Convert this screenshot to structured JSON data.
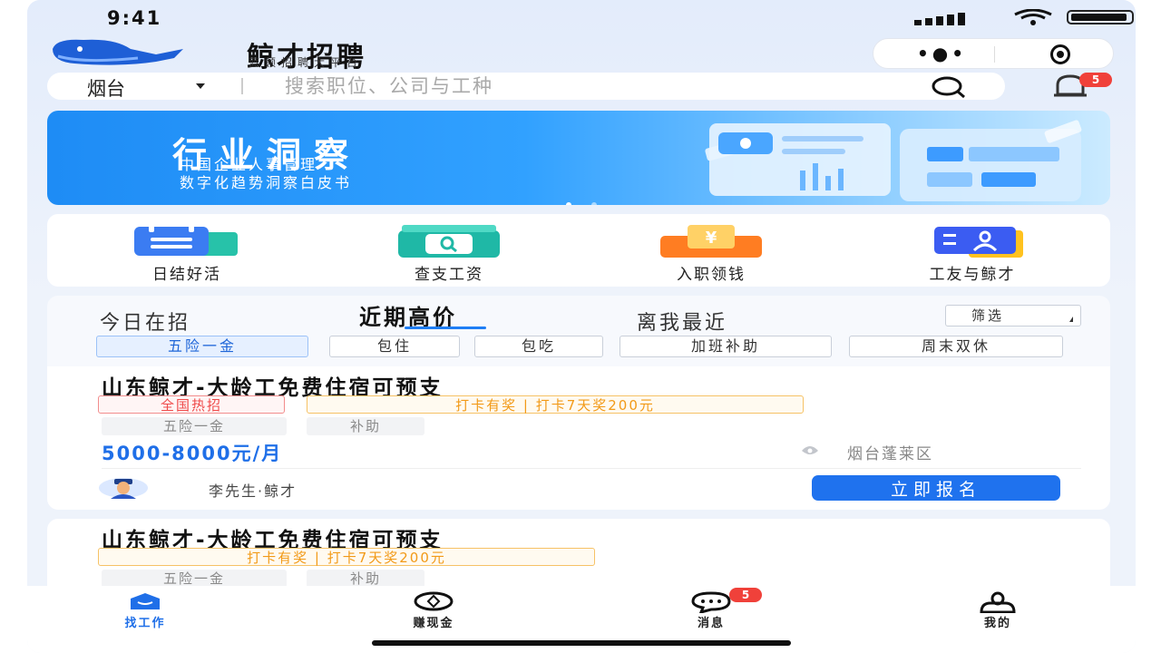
{
  "status_bar": {
    "time": "9:41"
  },
  "header": {
    "app_title": "鲸才招聘",
    "app_subtitle": "蓝领招聘大平台",
    "menu_icon": "more-dots-icon",
    "close_icon": "target-icon"
  },
  "search": {
    "city": "烟台",
    "placeholder": "搜索职位、公司与工种",
    "notification_count": "5"
  },
  "banner": {
    "title": "行业洞察",
    "subtitle_line1": "中国企业人事管理",
    "subtitle_line2": "数字化趋势洞察白皮书",
    "page_count": 3,
    "active_page": 1
  },
  "quick_entries": [
    {
      "label": "日结好活",
      "icon": "calendar-icon",
      "color": "#3b7cf2"
    },
    {
      "label": "查支工资",
      "icon": "search-wallet-icon",
      "color": "#1fb8a6"
    },
    {
      "label": "入职领钱",
      "icon": "yuan-wallet-icon",
      "color": "#ff8a2c"
    },
    {
      "label": "工友与鲸才",
      "icon": "id-card-icon",
      "color": "#3b5cf2"
    }
  ],
  "list": {
    "tabs": [
      "今日在招",
      "近期高价",
      "离我最近"
    ],
    "active_tab": "近期高价",
    "filter_label": "筛选",
    "chips": [
      "五险一金",
      "包住",
      "包吃",
      "加班补助",
      "周末双休"
    ],
    "active_chip": "五险一金"
  },
  "jobs": [
    {
      "title": "山东鲸才-大龄工免费住宿可预支",
      "hot_tag": "全国热招",
      "prize_tag": "打卡有奖 | 打卡7天奖200元",
      "benefits": [
        "五险一金",
        "补助"
      ],
      "salary": "5000-8000元/月",
      "location": "烟台蓬莱区",
      "recruiter": "李先生·鲸才",
      "apply_label": "立即报名"
    },
    {
      "title": "山东鲸才-大龄工免费住宿可预支",
      "prize_tag": "打卡有奖 | 打卡7天奖200元",
      "benefits": [
        "五险一金",
        "补助"
      ]
    }
  ],
  "tabbar": {
    "items": [
      {
        "label": "找工作",
        "icon": "home-icon",
        "active": true
      },
      {
        "label": "赚现金",
        "icon": "coin-icon",
        "active": false
      },
      {
        "label": "消息",
        "icon": "chat-icon",
        "active": false,
        "badge": "5"
      },
      {
        "label": "我的",
        "icon": "user-icon",
        "active": false
      }
    ]
  },
  "colors": {
    "primary": "#1f72ee",
    "hot": "#ef4a4a",
    "prize": "#f29a18",
    "background": "#eef3fb"
  }
}
